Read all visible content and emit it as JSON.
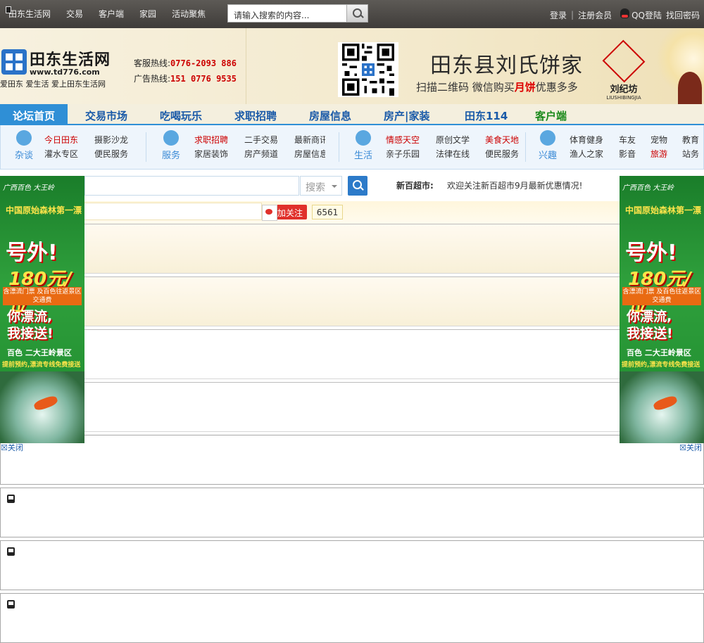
{
  "topbar": {
    "nav": [
      "田东生活网",
      "交易",
      "客户端",
      "家园",
      "活动聚焦"
    ],
    "search_placeholder": "请输入搜索的内容...",
    "login": "登录",
    "register": "注册会员",
    "qq_login": "QQ登陆",
    "find_password": "找回密码"
  },
  "header": {
    "logo_name": "田东生活网",
    "logo_url": "www.td776.com",
    "logo_slogan": "爱田东  爱生活  爱上田东生活网",
    "service_label": "客服热线:",
    "service_phone": "0776-2093 886",
    "ad_label": "广告热线:",
    "ad_phone": "151 0776 9535",
    "ad_title": "田东县刘氏饼家",
    "ad_sub_pre": "扫描二维码 微信购买",
    "ad_sub_hl": "月饼",
    "ad_sub_post": "优惠多多",
    "brand_name": "刘纪坊",
    "brand_sub": "LIUSHIBINGJIA"
  },
  "mainnav": {
    "active": "论坛首页",
    "items": [
      "交易市场",
      "吃喝玩乐",
      "求职招聘",
      "房屋信息",
      "房产|家装",
      "田东114"
    ],
    "client": "客户端"
  },
  "subnav": {
    "groups": [
      {
        "label": "杂谈",
        "color": "#5aa7e0",
        "links": [
          {
            "t": "今日田东",
            "red": true
          },
          {
            "t": "摄影沙龙"
          },
          {
            "t": "灌水专区"
          },
          {
            "t": "便民服务"
          }
        ]
      },
      {
        "label": "服务",
        "color": "#5aa7e0",
        "links": [
          {
            "t": "求职招聘",
            "red": true
          },
          {
            "t": "二手交易"
          },
          {
            "t": "最新商讯"
          },
          {
            "t": "家居装饰"
          },
          {
            "t": "房产频道"
          },
          {
            "t": "房屋信息"
          }
        ]
      },
      {
        "label": "生活",
        "color": "#5aa7e0",
        "links": [
          {
            "t": "情感天空",
            "red": true
          },
          {
            "t": "原创文学"
          },
          {
            "t": "美食天地",
            "red": true
          },
          {
            "t": "亲子乐园"
          },
          {
            "t": "法律在线"
          },
          {
            "t": "便民服务"
          }
        ]
      },
      {
        "label": "兴趣",
        "color": "#5aa7e0",
        "links": [
          {
            "t": "体育健身"
          },
          {
            "t": "车友"
          },
          {
            "t": "宠物"
          },
          {
            "t": "教育"
          },
          {
            "t": "渔人之家"
          },
          {
            "t": "影音"
          },
          {
            "t": "旅游",
            "red": true
          },
          {
            "t": "站务"
          }
        ]
      }
    ]
  },
  "sidead": {
    "t1": "广西百色 大王岭",
    "t2": "中国原始森林第一漂",
    "t3": "号外!",
    "t4": "180元/位",
    "band": "含漂流门票 及百色往返景区交通费",
    "t5a": "你漂流,",
    "t5b": "我接送!",
    "t6": "百色 二大王岭景区",
    "t7": "提前预约,漂流专线免费接送",
    "close": "关闭"
  },
  "search2": {
    "select": "搜索",
    "market_label": "新百超市:",
    "market_text": "欢迎关注新百超市9月最新优惠情况!"
  },
  "follow": {
    "label": "加关注",
    "count": "6561"
  }
}
